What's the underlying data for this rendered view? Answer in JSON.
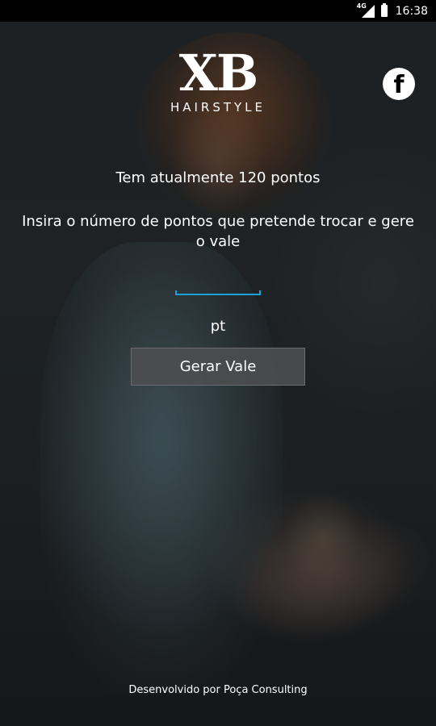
{
  "status_bar": {
    "network": "4G",
    "battery_level": 1.0,
    "time": "16:38"
  },
  "logo": {
    "mark": "XB",
    "subtitle": "HAIRSTYLE"
  },
  "facebook_button": {
    "glyph": "f",
    "icon": "facebook-icon"
  },
  "points": {
    "summary": "Tem atualmente 120 pontos",
    "instruction": "Insira o número de pontos que pretende trocar e gere o vale",
    "input_value": "",
    "unit": "pt"
  },
  "actions": {
    "generate_label": "Gerar Vale"
  },
  "footer": {
    "credit": "Desenvolvido por Poça Consulting"
  },
  "colors": {
    "accent": "#1ba3d8",
    "button_bg": "#4b4e50",
    "status_bar_bg": "#000000"
  }
}
